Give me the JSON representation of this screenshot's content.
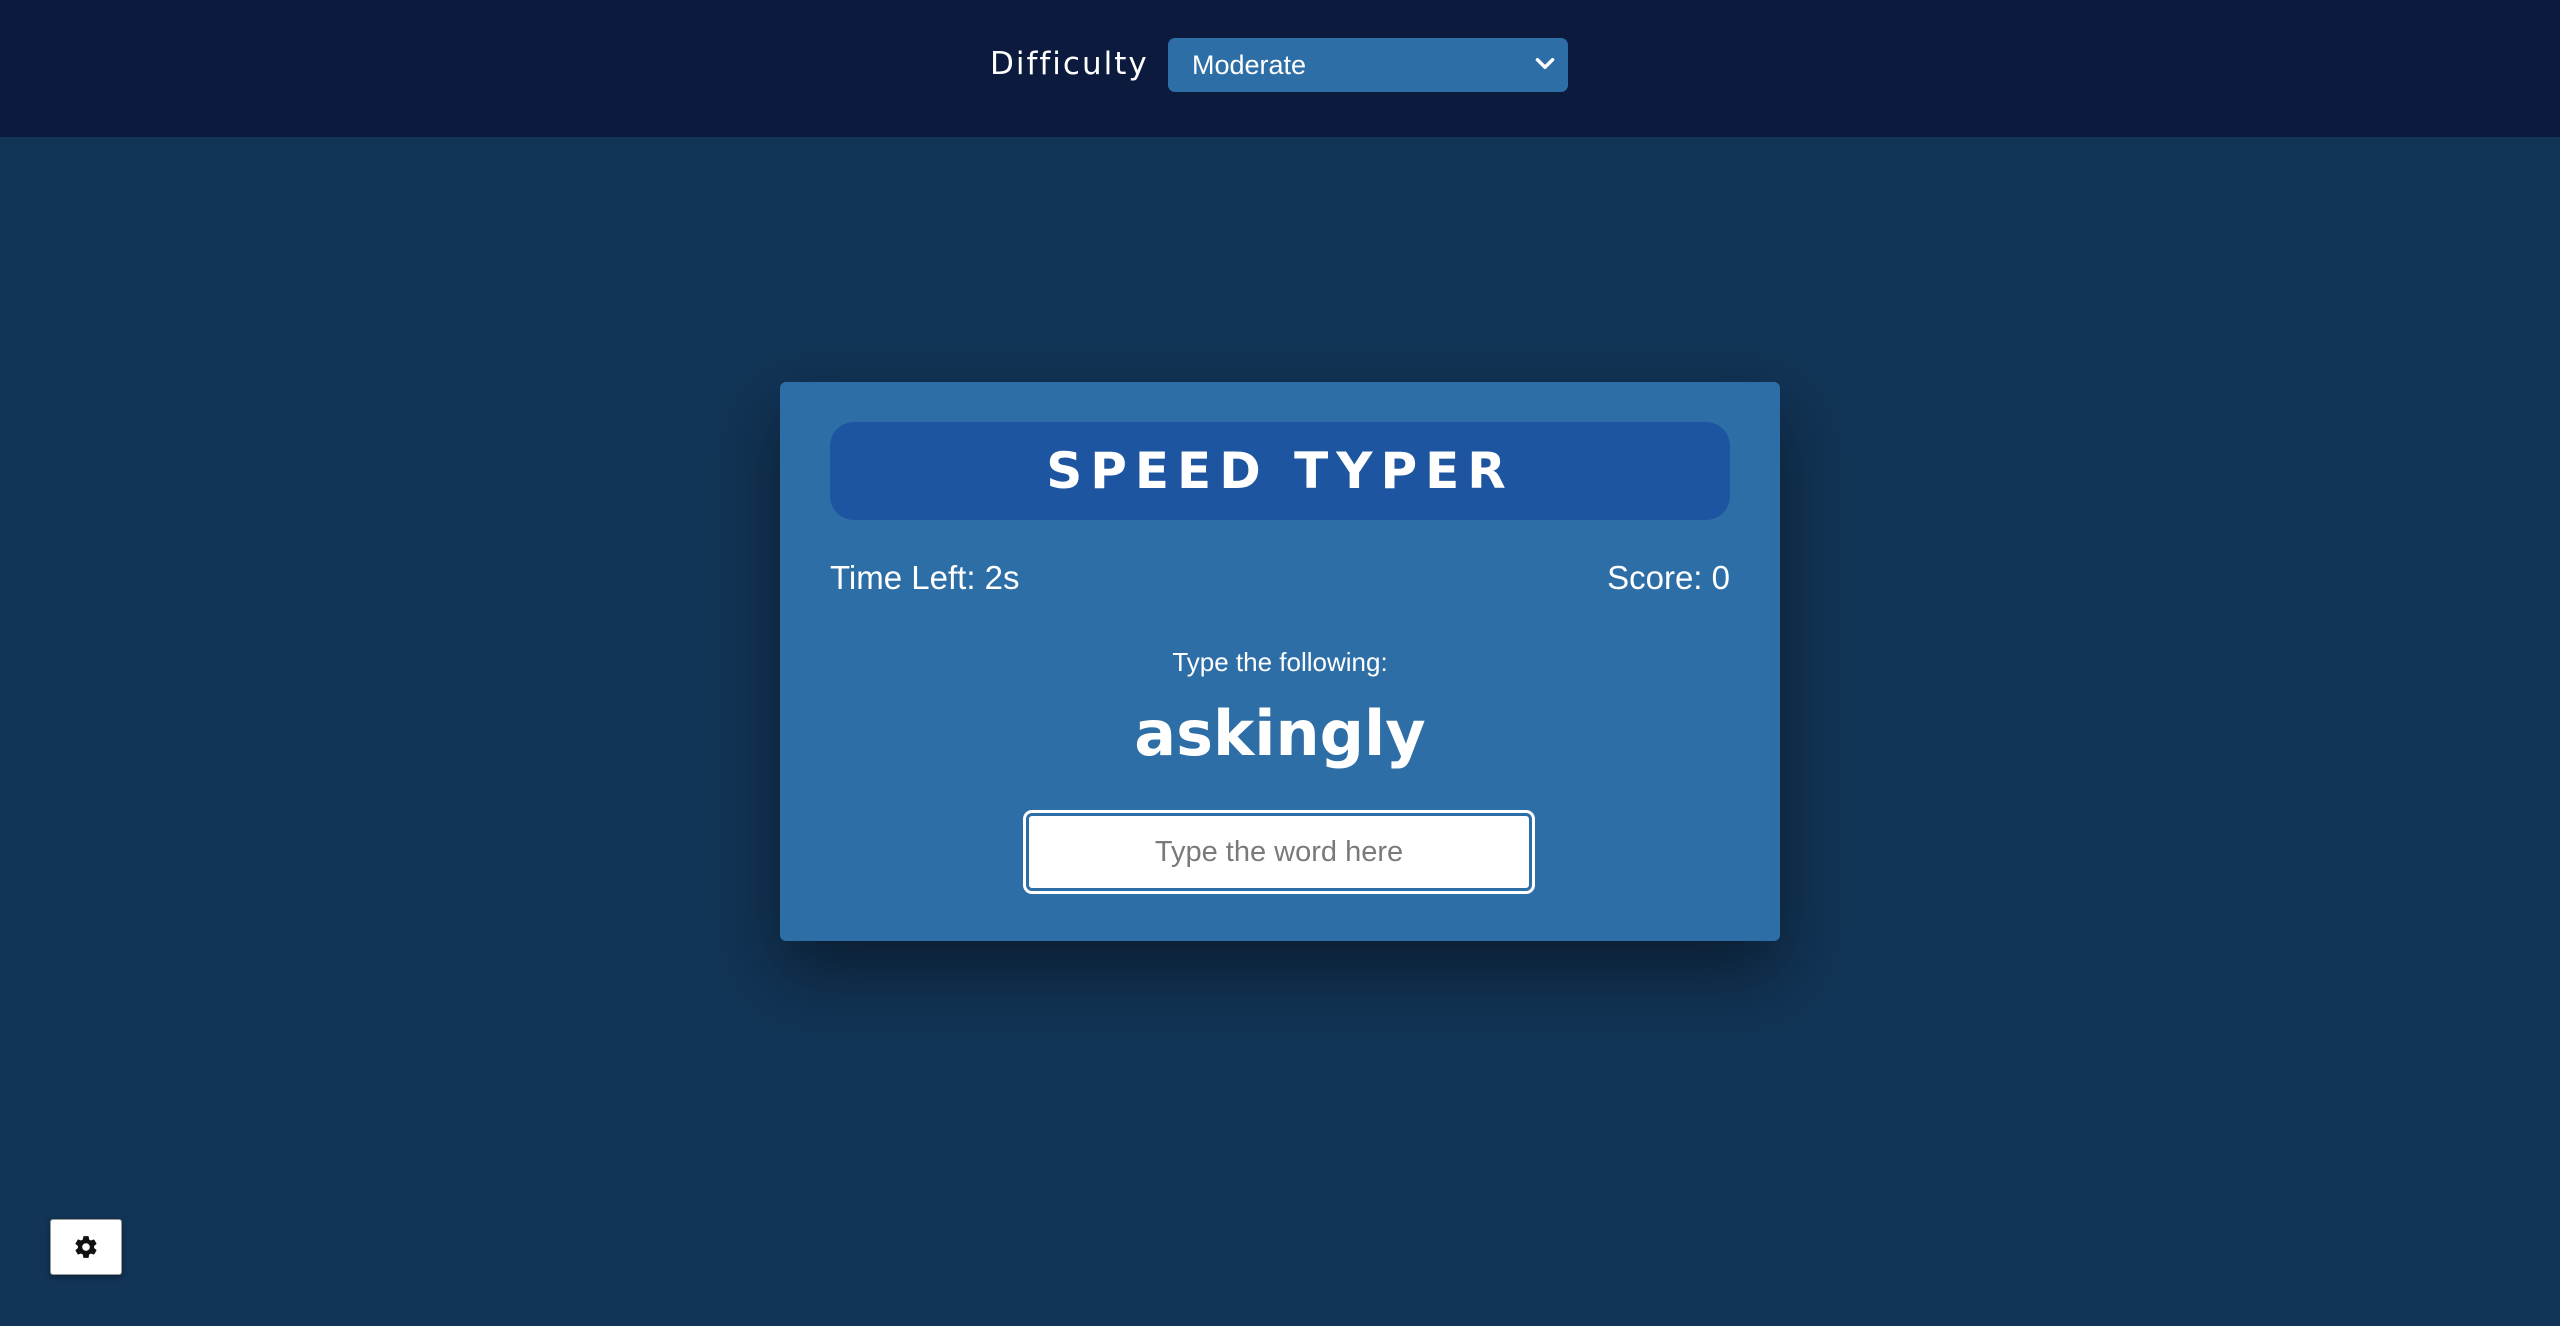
{
  "header": {
    "difficulty_label": "Difficulty",
    "difficulty_selected": "Moderate"
  },
  "game": {
    "title": "SPEED TYPER",
    "time_left": "Time Left: 2s",
    "score": "Score: 0",
    "prompt_label": "Type the following:",
    "target_word": "askingly",
    "input_placeholder": "Type the word here",
    "input_value": ""
  },
  "settings": {
    "icon": "gear-icon"
  },
  "colors": {
    "page_background": "#123456",
    "top_bar": "#0b1a3d",
    "card": "#2d6ea6",
    "title_pill": "#1e55a0",
    "text": "#ffffff"
  }
}
